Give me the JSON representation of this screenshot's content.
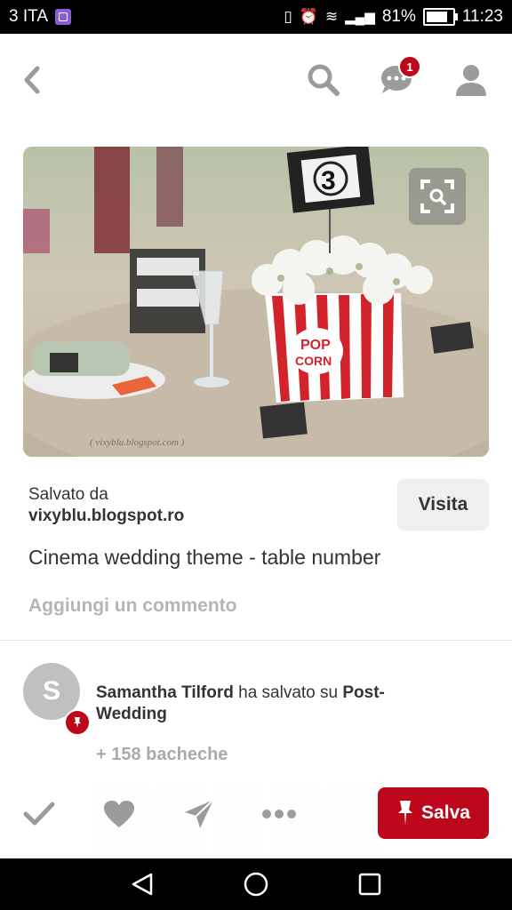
{
  "status_bar": {
    "carrier": "3 ITA",
    "battery": "81%",
    "time": "11:23"
  },
  "header": {
    "notification_count": "1"
  },
  "pin": {
    "saved_from_label": "Salvato da",
    "source_site": "vixyblu.blogspot.ro",
    "visit_button": "Visita",
    "title": "Cinema wedding theme - table number",
    "comment_placeholder": "Aggiungi un commento",
    "image_watermark": "( vixyblu.blogspot.com )"
  },
  "activity": {
    "avatar_initial": "S",
    "user_name": "Samantha Tilford",
    "action_text": " ha salvato su ",
    "board_name": "Post-Wedding",
    "more_boards": "+ 158 bacheche"
  },
  "actions": {
    "save_button": "Salva"
  },
  "colors": {
    "brand_red": "#bd081c",
    "icon_gray": "#9b9b9b"
  }
}
